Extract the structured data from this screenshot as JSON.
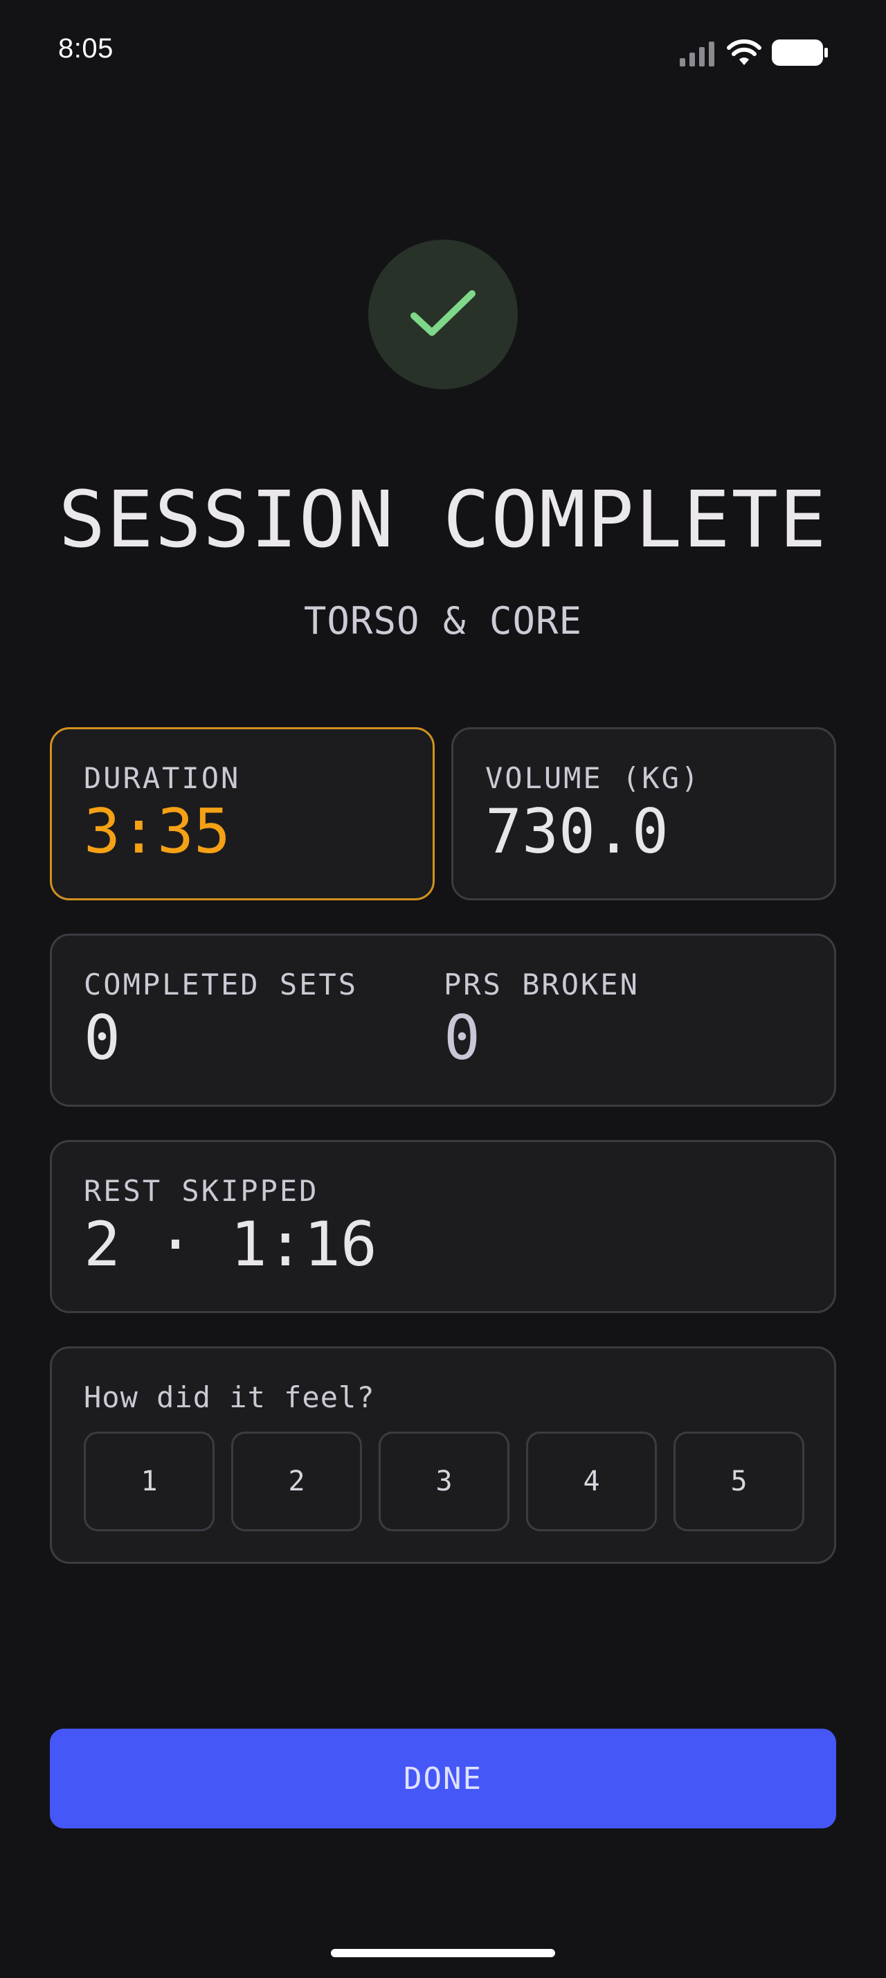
{
  "status_bar": {
    "time": "8:05",
    "icons": [
      "signal-icon",
      "wifi-icon",
      "battery-icon"
    ]
  },
  "badge": {
    "icon": "checkmark-icon",
    "color": "#7fd78a"
  },
  "title": "SESSION COMPLETE",
  "subtitle": "TORSO & CORE",
  "stats": {
    "duration": {
      "label": "DURATION",
      "value": "3:35"
    },
    "volume": {
      "label": "VOLUME (KG)",
      "value": "730.0"
    },
    "completed_sets": {
      "label": "COMPLETED SETS",
      "value": "0"
    },
    "prs_broken": {
      "label": "PRS BROKEN",
      "value": "0"
    },
    "rest_skipped": {
      "label": "REST SKIPPED",
      "value": "2 · 1:16"
    }
  },
  "feel": {
    "question": "How did it feel?",
    "options": [
      "1",
      "2",
      "3",
      "4",
      "5"
    ]
  },
  "done_label": "DONE",
  "colors": {
    "background": "#131316",
    "accent_orange": "#f5a115",
    "primary_button": "#4657f7",
    "check_green": "#7fd78a"
  }
}
